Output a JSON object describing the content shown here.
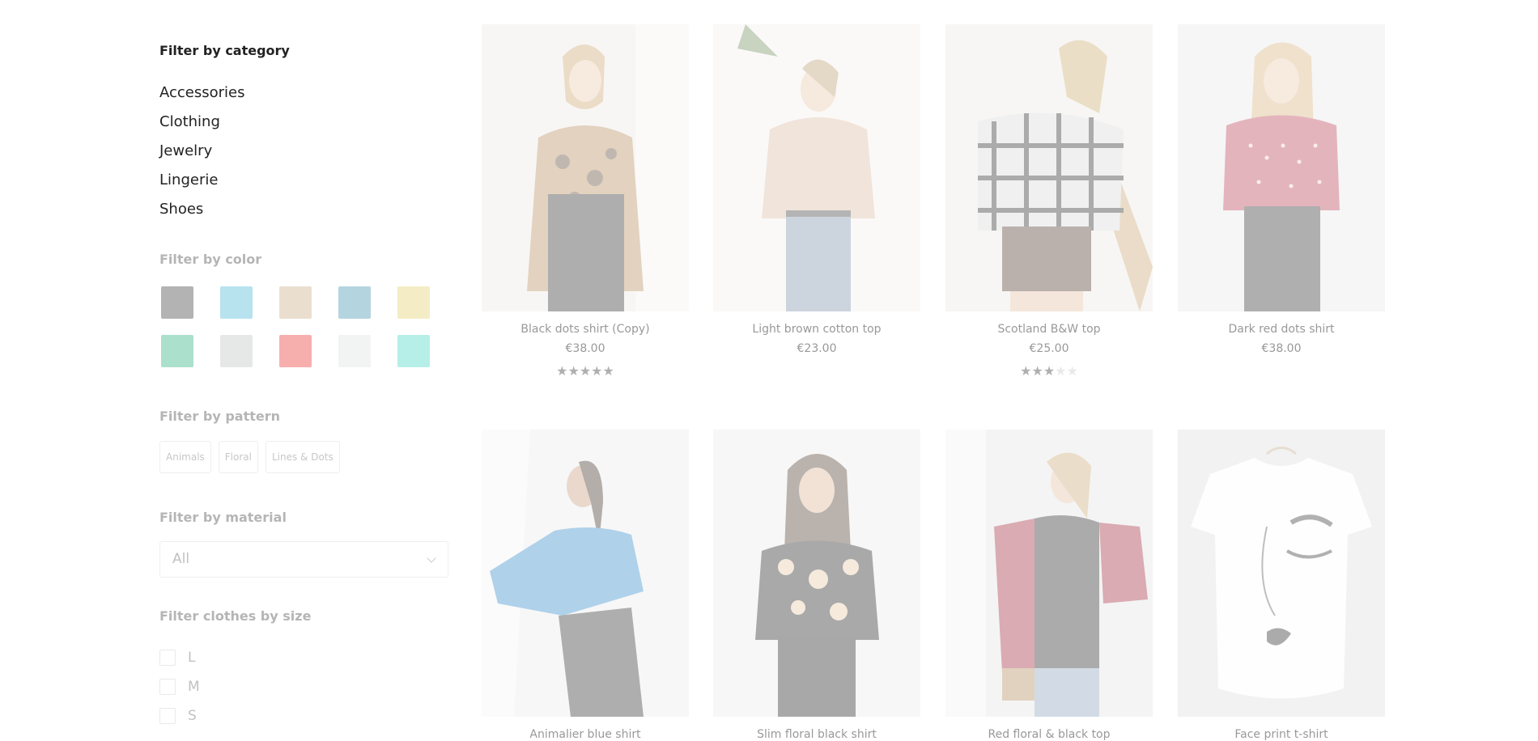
{
  "sidebar": {
    "category_heading": "Filter by category",
    "categories": [
      "Accessories",
      "Clothing",
      "Jewelry",
      "Lingerie",
      "Shoes"
    ],
    "color_heading": "Filter by color",
    "colors": [
      "#b3b3b3",
      "#b7e3ef",
      "#eadfcf",
      "#b4d5e0",
      "#f4ecc5",
      "#abe0cd",
      "#e6e8e7",
      "#f7afae",
      "#f2f3f3",
      "#b6efe8"
    ],
    "pattern_heading": "Filter by pattern",
    "patterns": [
      "Animals",
      "Floral",
      "Lines & Dots"
    ],
    "material_heading": "Filter by material",
    "material_selected": "All",
    "size_heading": "Filter clothes by size",
    "sizes": [
      "L",
      "M",
      "S"
    ]
  },
  "products": [
    {
      "name": "Black dots shirt (Copy)",
      "price": "€38.00",
      "rating": 5
    },
    {
      "name": "Light brown cotton top",
      "price": "€23.00",
      "rating": null
    },
    {
      "name": "Scotland B&W top",
      "price": "€25.00",
      "rating": 3
    },
    {
      "name": "Dark red dots shirt",
      "price": "€38.00",
      "rating": null
    },
    {
      "name": "Animalier blue shirt",
      "price": "",
      "rating": null
    },
    {
      "name": "Slim floral black shirt",
      "price": "",
      "rating": null
    },
    {
      "name": "Red floral & black top",
      "price": "",
      "rating": null
    },
    {
      "name": "Face print t-shirt",
      "price": "",
      "rating": null
    }
  ]
}
